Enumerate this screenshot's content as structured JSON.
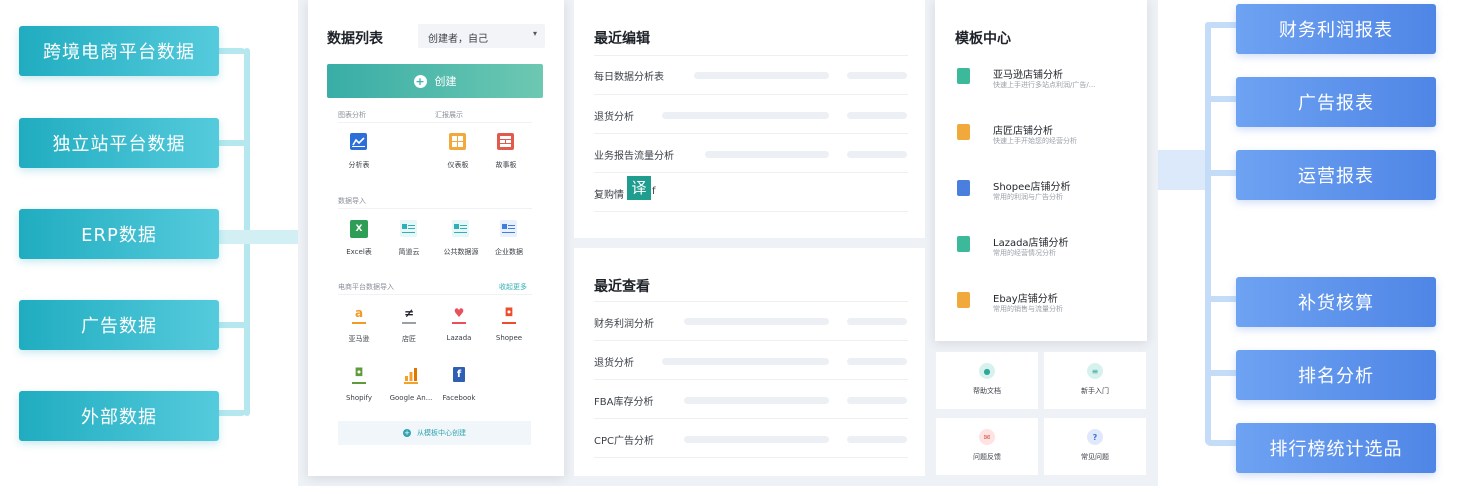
{
  "left_tags": [
    "跨境电商平台数据",
    "独立站平台数据",
    "ERP数据",
    "广告数据",
    "外部数据"
  ],
  "right_tags": [
    "财务利润报表",
    "广告报表",
    "运营报表",
    "补货核算",
    "排名分析",
    "排行榜统计选品"
  ],
  "data_list": {
    "title": "数据列表",
    "filter_value": "创建者，自己",
    "create_label": "创建",
    "section_chart": "图表分析",
    "section_report": "汇报展示",
    "analysis_table": "分析表",
    "dashboard": "仪表板",
    "storyboard": "故事板",
    "section_import": "数据导入",
    "excel": "Excel表",
    "jiandao": "简道云",
    "public_data": "公共数据源",
    "enterprise_data": "企业数据",
    "section_platform": "电商平台数据导入",
    "collapse_more": "收起更多",
    "platforms": [
      "亚马逊",
      "店匠",
      "Lazada",
      "Shopee",
      "Shopify",
      "Google An...",
      "Facebook"
    ],
    "from_template": "从模板中心创建"
  },
  "recent_edit": {
    "title": "最近编辑",
    "items": [
      "每日数据分析表",
      "退货分析",
      "业务报告流量分析",
      "复购情"
    ],
    "translate_badge": "译"
  },
  "recent_view": {
    "title": "最近查看",
    "items": [
      "财务利润分析",
      "退货分析",
      "FBA库存分析",
      "CPC广告分析"
    ]
  },
  "templates": {
    "title": "模板中心",
    "items": [
      {
        "title": "亚马逊店铺分析",
        "sub": "快速上手进行多站点利润/广告/..."
      },
      {
        "title": "店匠店铺分析",
        "sub": "快速上手开始您的经营分析"
      },
      {
        "title": "Shopee店铺分析",
        "sub": "常用的利润与广告分析"
      },
      {
        "title": "Lazada店铺分析",
        "sub": "常用的经营情况分析"
      },
      {
        "title": "Ebay店铺分析",
        "sub": "常用的销售与流量分析"
      }
    ]
  },
  "help": {
    "docs": "帮助文档",
    "beginner": "新手入门",
    "feedback": "问题反馈",
    "faq": "常见问题"
  },
  "colors": {
    "left_tag": "#2fb6c8",
    "right_tag": "#5b8fec",
    "create_button": "#3eb4ad"
  }
}
